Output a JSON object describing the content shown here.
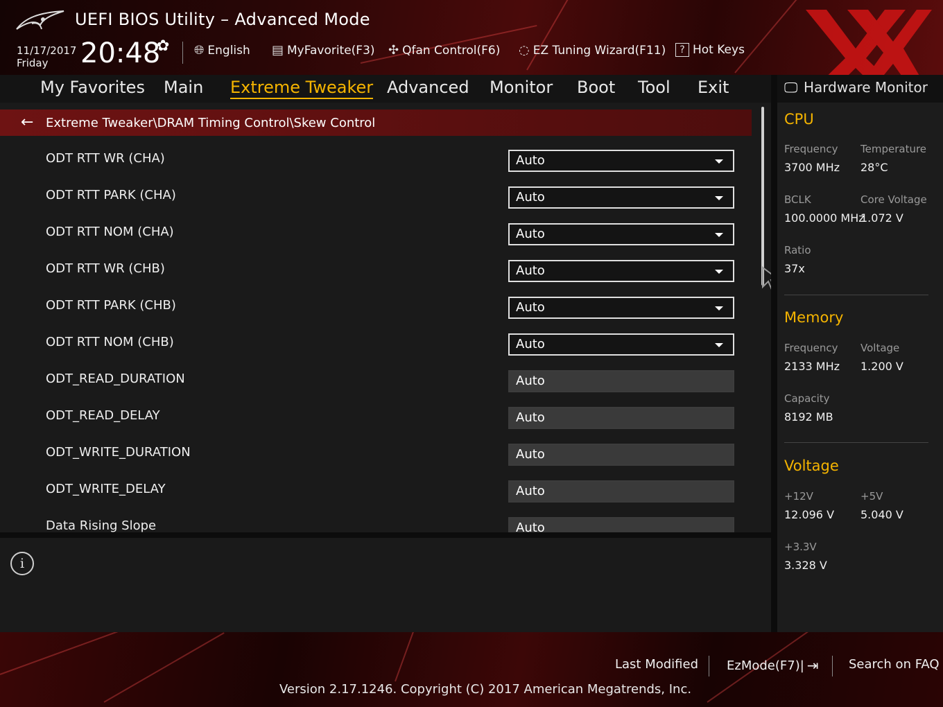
{
  "header": {
    "title": "UEFI BIOS Utility – Advanced Mode",
    "date": "11/17/2017",
    "day": "Friday",
    "time": "20:48",
    "buttons": {
      "language": "English",
      "myfavorite": "MyFavorite(F3)",
      "qfan": "Qfan Control(F6)",
      "ez_tuning": "EZ Tuning Wizard(F11)",
      "hotkeys": "Hot Keys"
    },
    "icons": [
      "logo",
      "gear-icon",
      "globe-icon",
      "favorite-icon",
      "fan-icon",
      "bulb-icon",
      "question-icon"
    ]
  },
  "nav": {
    "tabs": [
      "My Favorites",
      "Main",
      "Extreme Tweaker",
      "Advanced",
      "Monitor",
      "Boot",
      "Tool",
      "Exit"
    ],
    "active_tab": "Extreme Tweaker"
  },
  "main": {
    "breadcrumb": "Extreme Tweaker\\DRAM Timing Control\\Skew Control",
    "settings": [
      {
        "label": "ODT RTT WR (CHA)",
        "value": "Auto",
        "type": "dropdown"
      },
      {
        "label": "ODT RTT PARK (CHA)",
        "value": "Auto",
        "type": "dropdown"
      },
      {
        "label": "ODT RTT NOM (CHA)",
        "value": "Auto",
        "type": "dropdown"
      },
      {
        "label": "ODT RTT WR (CHB)",
        "value": "Auto",
        "type": "dropdown"
      },
      {
        "label": "ODT RTT PARK (CHB)",
        "value": "Auto",
        "type": "dropdown"
      },
      {
        "label": "ODT RTT NOM (CHB)",
        "value": "Auto",
        "type": "dropdown"
      },
      {
        "label": "ODT_READ_DURATION",
        "value": "Auto",
        "type": "text"
      },
      {
        "label": "ODT_READ_DELAY",
        "value": "Auto",
        "type": "text"
      },
      {
        "label": "ODT_WRITE_DURATION",
        "value": "Auto",
        "type": "text"
      },
      {
        "label": "ODT_WRITE_DELAY",
        "value": "Auto",
        "type": "text"
      },
      {
        "label": "Data Rising Slope",
        "value": "Auto",
        "type": "text"
      }
    ]
  },
  "hardware_monitor": {
    "title": "Hardware Monitor",
    "cpu": {
      "heading": "CPU",
      "frequency_label": "Frequency",
      "frequency": "3700 MHz",
      "temperature_label": "Temperature",
      "temperature": "28°C",
      "bclk_label": "BCLK",
      "bclk": "100.0000 MHz",
      "core_voltage_label": "Core Voltage",
      "core_voltage": "1.072 V",
      "ratio_label": "Ratio",
      "ratio": "37x"
    },
    "memory": {
      "heading": "Memory",
      "frequency_label": "Frequency",
      "frequency": "2133 MHz",
      "voltage_label": "Voltage",
      "voltage": "1.200 V",
      "capacity_label": "Capacity",
      "capacity": "8192 MB"
    },
    "voltage": {
      "heading": "Voltage",
      "v12_label": "+12V",
      "v12": "12.096 V",
      "v5_label": "+5V",
      "v5": "5.040 V",
      "v33_label": "+3.3V",
      "v33": "3.328 V"
    }
  },
  "footer": {
    "last_modified": "Last Modified",
    "ezmode": "EzMode(F7)|",
    "search_faq": "Search on FAQ",
    "copyright": "Version 2.17.1246. Copyright (C) 2017 American Megatrends, Inc."
  },
  "colors": {
    "accent": "#f5b400",
    "breadcrumb_bg": "#6e1313",
    "panel_bg": "#1a1a1a",
    "brand_red": "#c81414"
  }
}
